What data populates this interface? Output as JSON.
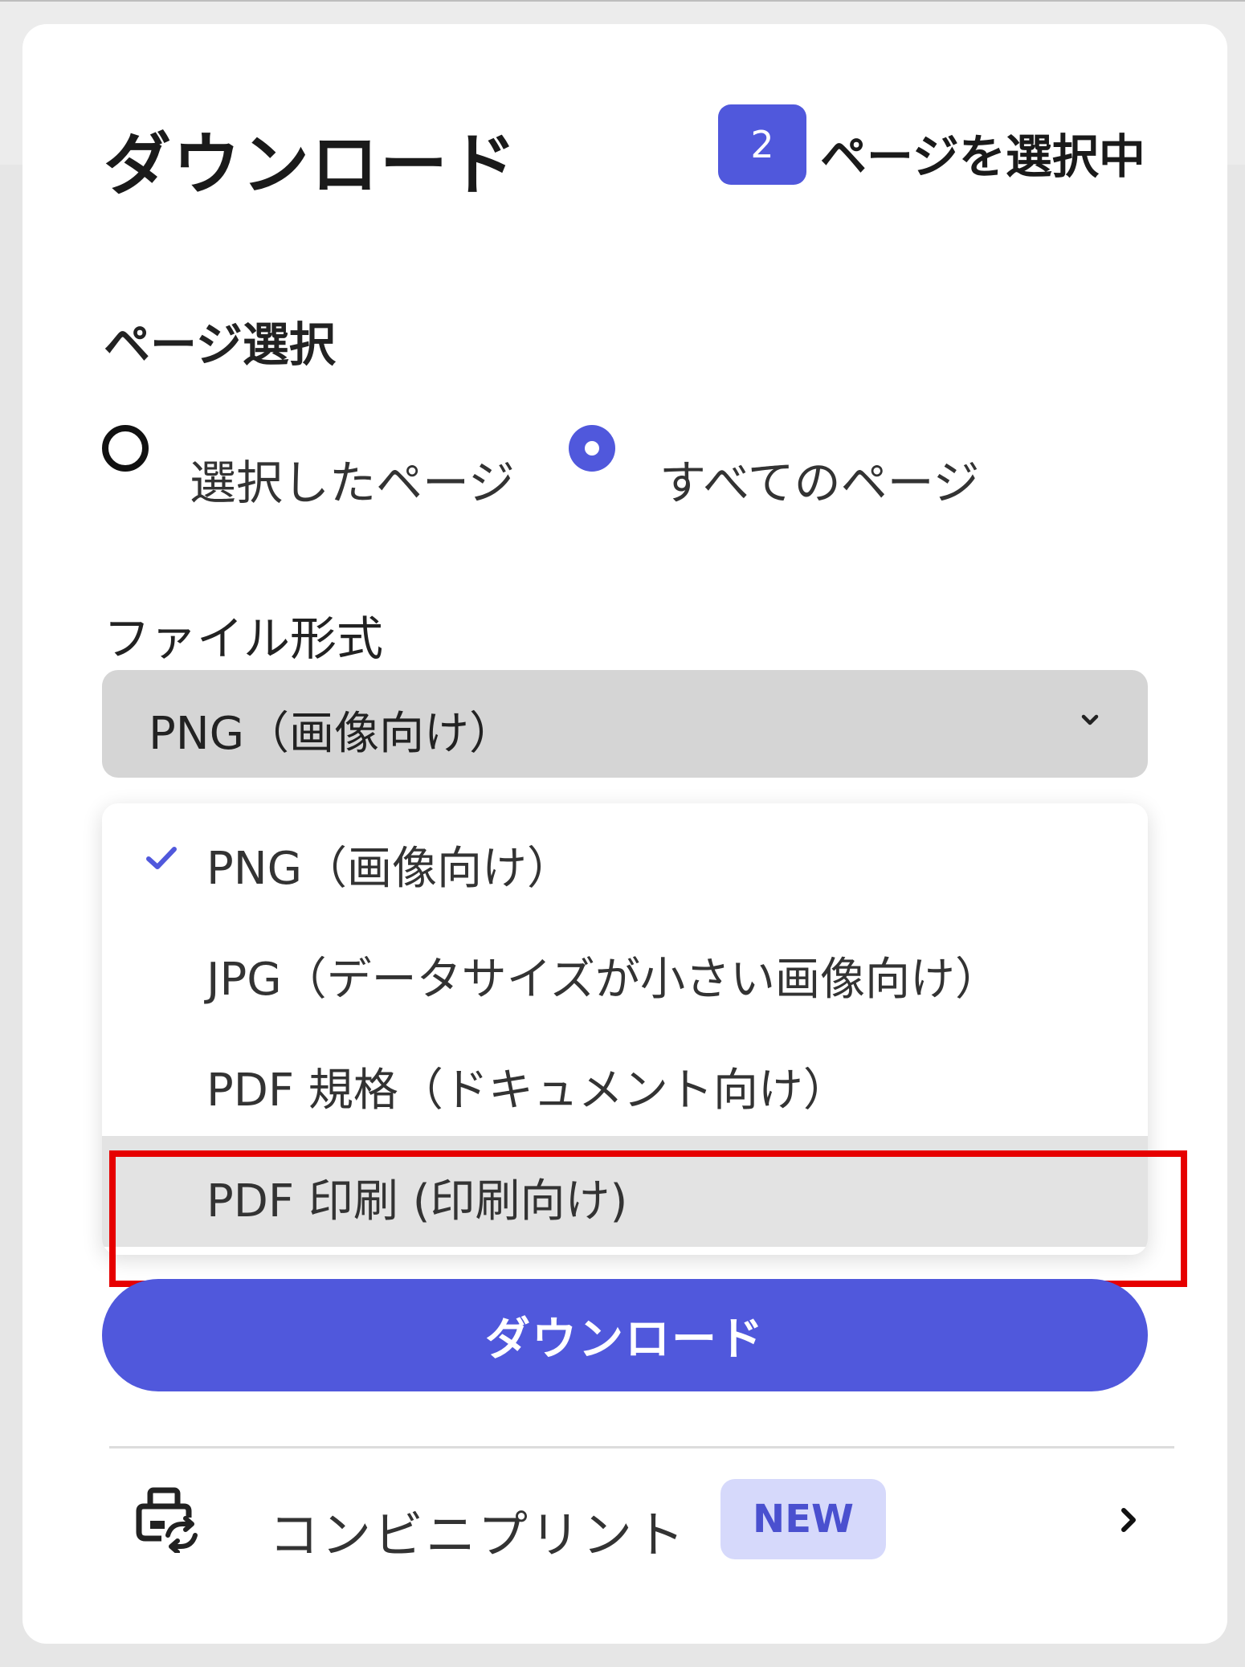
{
  "header": {
    "title": "ダウンロード",
    "selected_count": "2",
    "selected_text": "ページを選択中"
  },
  "page_selection": {
    "label": "ページ選択",
    "options": [
      {
        "label": "選択したページ",
        "selected": false
      },
      {
        "label": "すべてのページ",
        "selected": true
      }
    ]
  },
  "file_format": {
    "label": "ファイル形式",
    "selected_value": "PNG（画像向け）",
    "options": [
      {
        "label": "PNG（画像向け）",
        "checked": true
      },
      {
        "label": "JPG（データサイズが小さい画像向け）",
        "checked": false
      },
      {
        "label": "PDF 規格（ドキュメント向け）",
        "checked": false
      },
      {
        "label": "PDF 印刷 (印刷向け)",
        "checked": false,
        "hovered": true
      }
    ]
  },
  "download_button": {
    "label": "ダウンロード"
  },
  "convenience_print": {
    "label": "コンビニプリント",
    "badge": "NEW"
  },
  "colors": {
    "accent": "#5058dc",
    "highlight_border": "#e60000",
    "badge_bg": "#d6d9fb",
    "hover_bg": "#e3e3e3"
  },
  "icons": {
    "check": "check-icon",
    "chevron_down": "chevron-down-icon",
    "chevron_right": "chevron-right-icon",
    "print": "printer-icon"
  }
}
